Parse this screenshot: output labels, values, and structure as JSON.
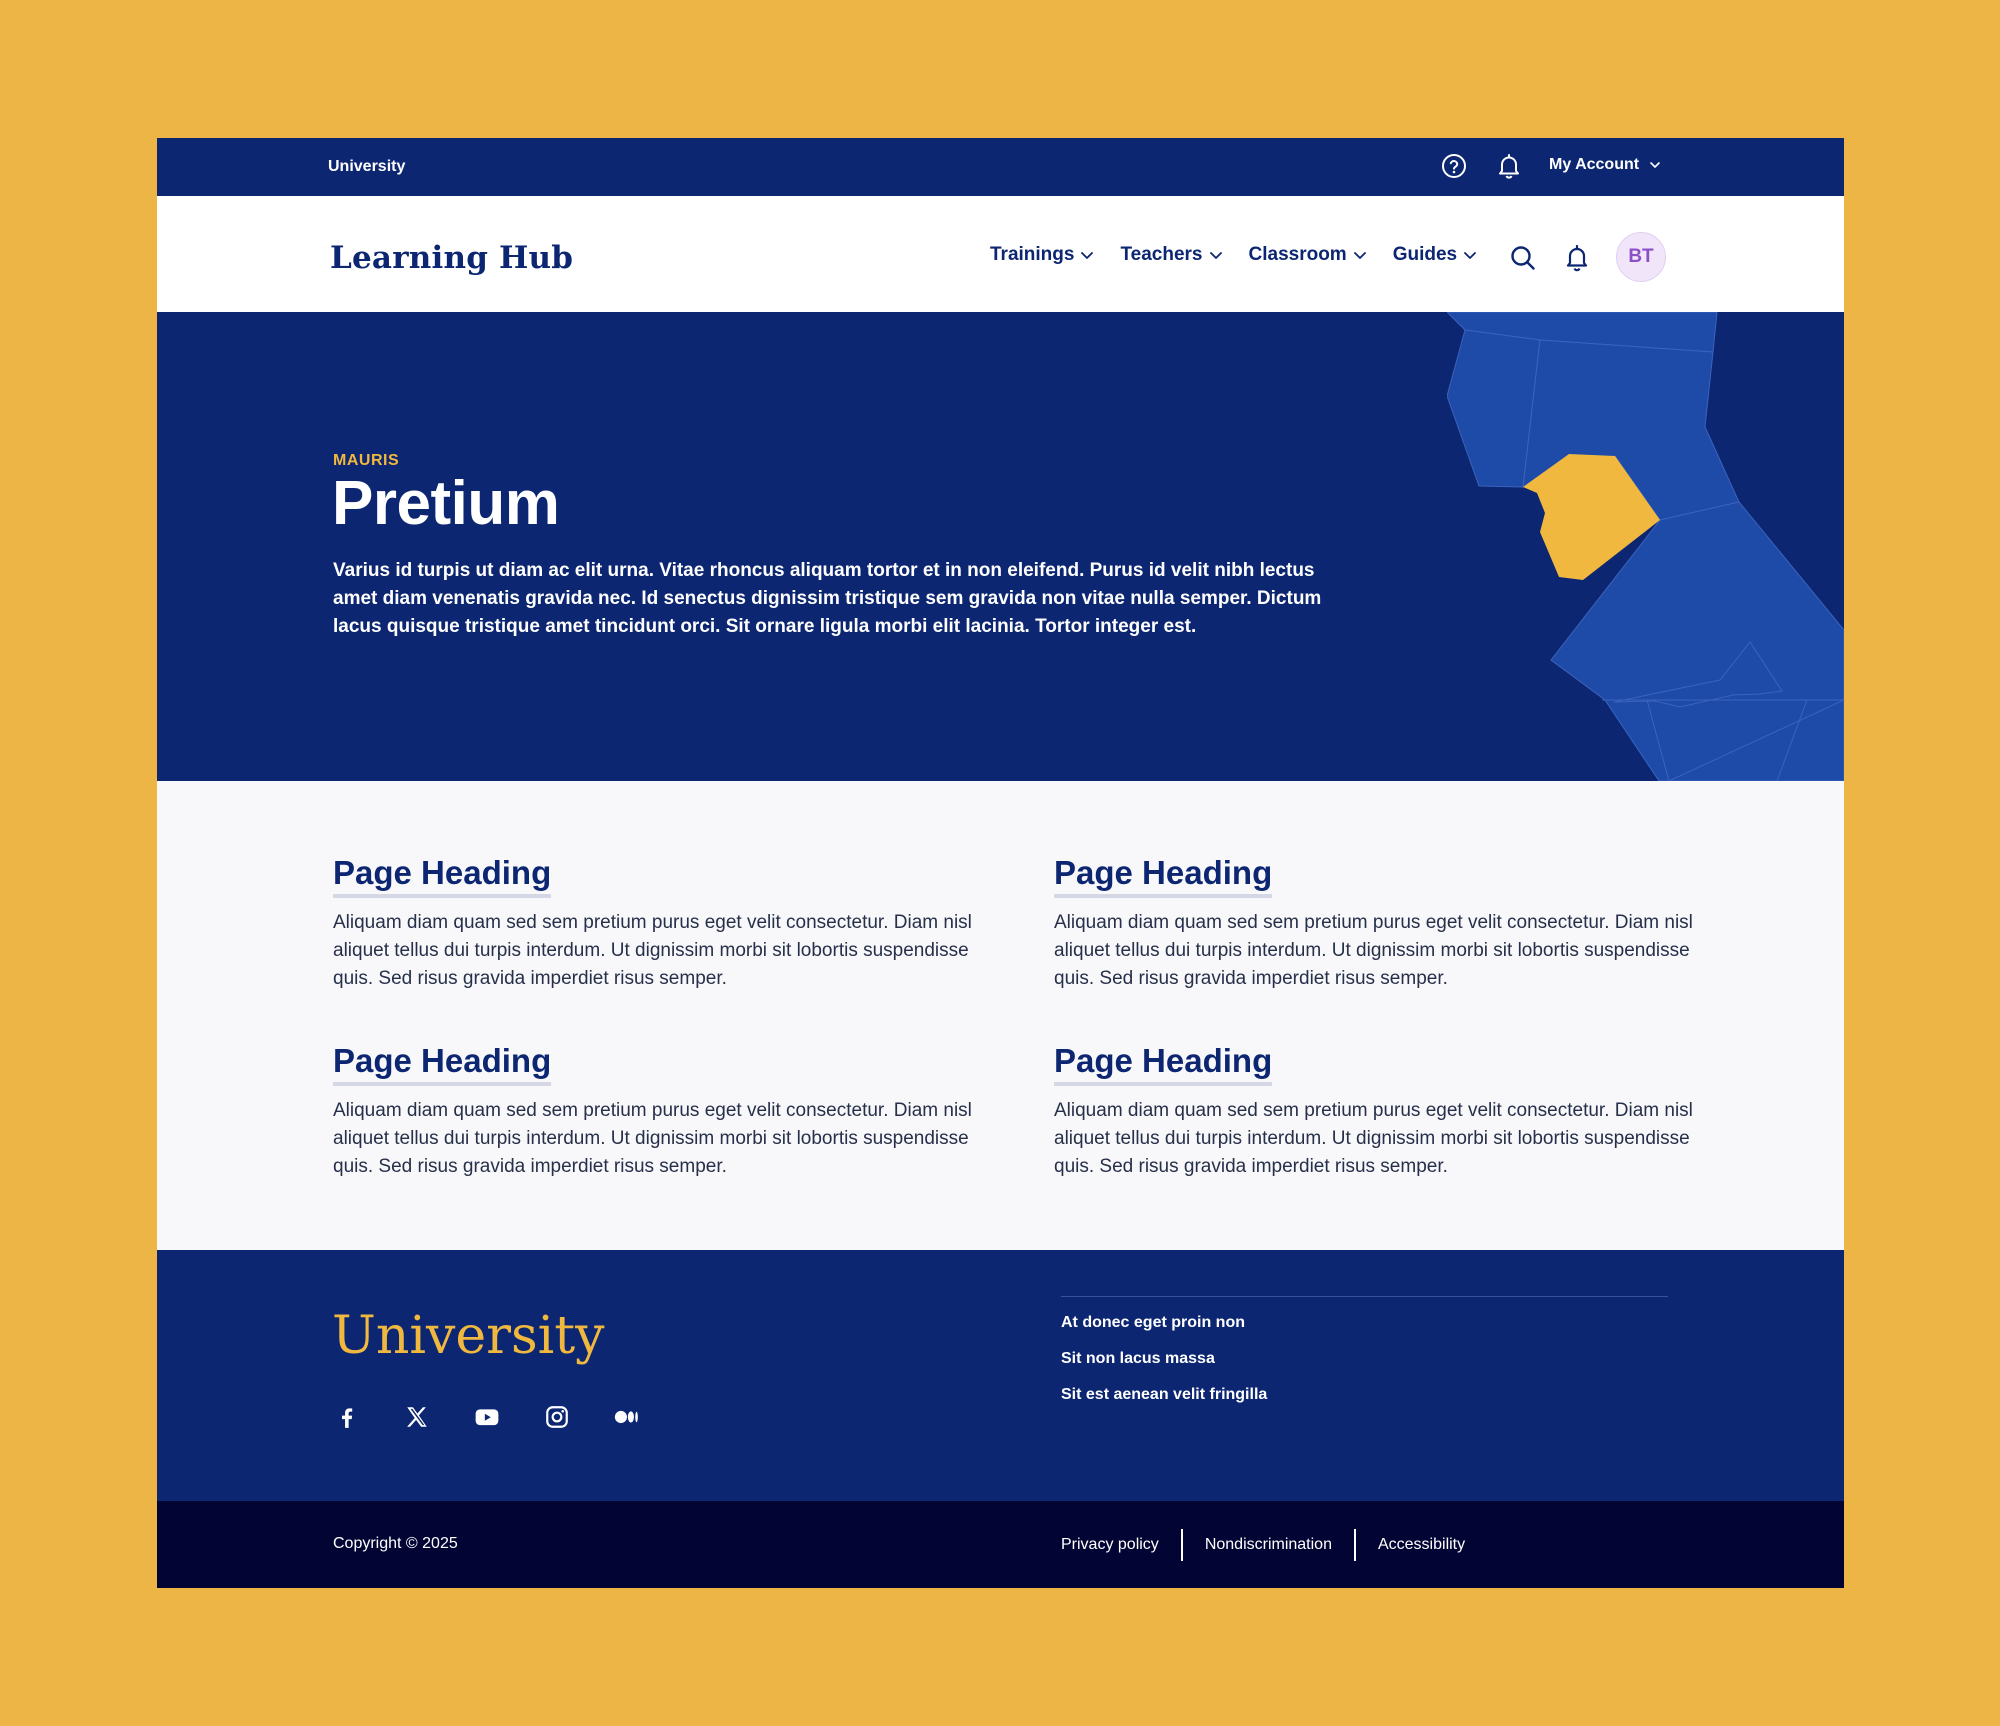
{
  "utility_bar": {
    "brand": "University",
    "account_label": "My Account",
    "icons": [
      "help-circle-icon",
      "bell-icon",
      "chevron-down-icon"
    ]
  },
  "navbar": {
    "logo": "Learning Hub",
    "menu": [
      {
        "label": "Trainings"
      },
      {
        "label": "Teachers"
      },
      {
        "label": "Classroom"
      },
      {
        "label": "Guides"
      }
    ],
    "avatar_initials": "BT"
  },
  "hero": {
    "eyebrow": "MAURIS",
    "title": "Pretium",
    "lead": "Varius id turpis ut diam ac elit urna. Vitae rhoncus aliquam tortor et in non eleifend. Purus id velit nibh lectus amet diam venenatis gravida nec. Id senectus dignissim tristique sem gravida non vitae nulla semper. Dictum lacus quisque tristique amet tincidunt orci. Sit ornare ligula morbi elit lacinia. Tortor integer est."
  },
  "content": {
    "cards": [
      {
        "heading": "Page Heading",
        "body": "Aliquam diam quam sed sem pretium purus eget velit consectetur. Diam nisl aliquet tellus dui turpis interdum. Ut dignissim morbi sit lobortis suspendisse quis. Sed risus gravida imperdiet risus semper."
      },
      {
        "heading": "Page Heading",
        "body": "Aliquam diam quam sed sem pretium purus eget velit consectetur. Diam nisl aliquet tellus dui turpis interdum. Ut dignissim morbi sit lobortis suspendisse quis. Sed risus gravida imperdiet risus semper."
      },
      {
        "heading": "Page Heading",
        "body": "Aliquam diam quam sed sem pretium purus eget velit consectetur. Diam nisl aliquet tellus dui turpis interdum. Ut dignissim morbi sit lobortis suspendisse quis. Sed risus gravida imperdiet risus semper."
      },
      {
        "heading": "Page Heading",
        "body": "Aliquam diam quam sed sem pretium purus eget velit consectetur. Diam nisl aliquet tellus dui turpis interdum. Ut dignissim morbi sit lobortis suspendisse quis. Sed risus gravida imperdiet risus semper."
      }
    ]
  },
  "footer": {
    "wordmark": "University",
    "social_icons": [
      "facebook-icon",
      "x-icon",
      "youtube-icon",
      "instagram-icon",
      "medium-icon"
    ],
    "links": [
      {
        "label": "At donec eget proin non"
      },
      {
        "label": "Sit non lacus massa"
      },
      {
        "label": "Sit est aenean velit fringilla"
      }
    ]
  },
  "bottom_bar": {
    "copyright": "Copyright © 2025",
    "legal_links": [
      {
        "label": "Privacy policy"
      },
      {
        "label": "Nondiscrimination"
      },
      {
        "label": "Accessibility"
      }
    ]
  },
  "colors": {
    "page_background": "#EDB545",
    "navy": "#0C2672",
    "map_blue": "#1E4BA8",
    "accent_gold": "#F0B83F",
    "bottom_bar": "#020533",
    "content_background": "#F8F8FA",
    "avatar_background": "#F1E5FA",
    "avatar_text": "#8B4FC8"
  }
}
